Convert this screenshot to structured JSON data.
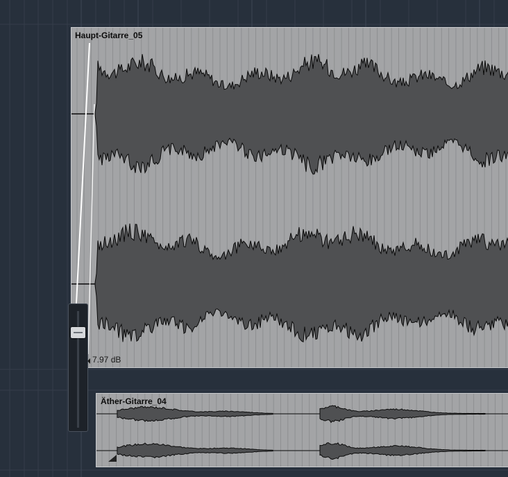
{
  "events": [
    {
      "name": "Haupt-Gitarre_05"
    },
    {
      "name": "Äther-Gitarre_04"
    }
  ],
  "volume_handle": {
    "readout": "7.97 dB"
  },
  "icons": {
    "fader_handle": "fader-handle-icon",
    "fade_marker": "fade-triangle-icon"
  },
  "colors": {
    "background": "#27303c",
    "event_body": "#a3a4a6",
    "waveform_fill": "#4f5052",
    "waveform_line": "#0a0a0a"
  }
}
